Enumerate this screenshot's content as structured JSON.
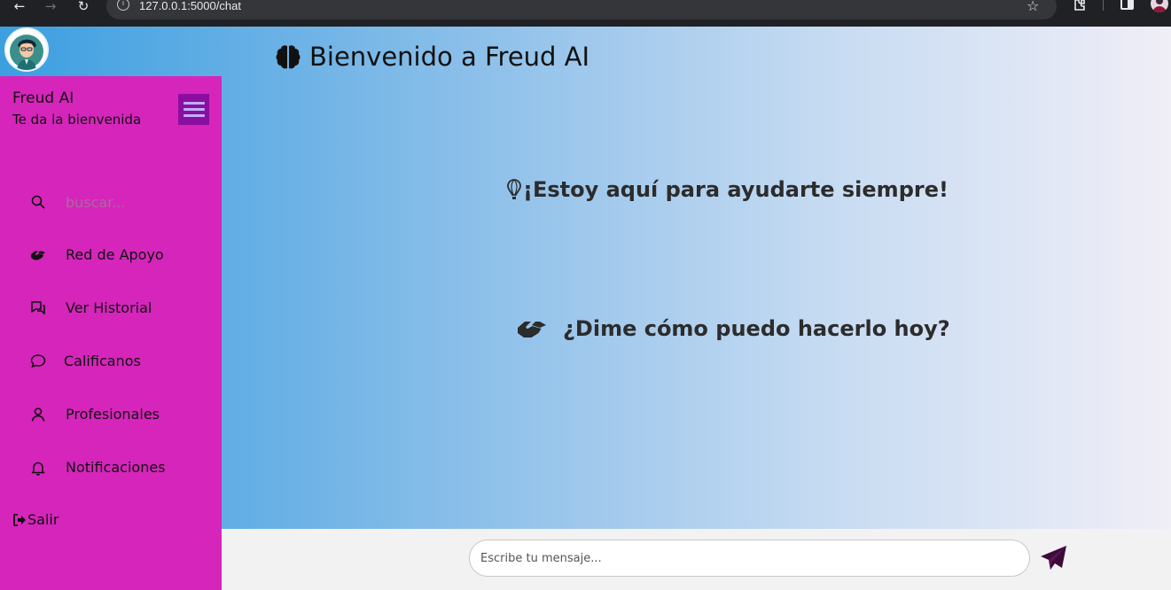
{
  "browser": {
    "url": "127.0.0.1:5000/chat"
  },
  "header": {
    "title": "Bienvenido a Freud AI"
  },
  "sidebar": {
    "brand": "Freud AI",
    "subtitle": "Te da la bienvenida",
    "search_placeholder": "buscar...",
    "items": [
      {
        "label": "Red de Apoyo",
        "icon": "handshake-icon"
      },
      {
        "label": "Ver Historial",
        "icon": "chat-history-icon"
      },
      {
        "label": "Calificanos",
        "icon": "comment-icon"
      },
      {
        "label": "Profesionales",
        "icon": "user-icon"
      },
      {
        "label": "Notificaciones",
        "icon": "bell-icon"
      }
    ],
    "logout": "Salir"
  },
  "main": {
    "headline": "¡Estoy aquí para ayudarte siempre!",
    "prompt": "¿Dime cómo puedo hacerlo hoy?"
  },
  "composer": {
    "placeholder": "Escribe tu mensaje..."
  },
  "colors": {
    "sidebar": "#d625bb",
    "menu_toggle": "#8a0fa0",
    "send_icon": "#3d0b3a",
    "gradient_start": "#3c9fe0",
    "gradient_end": "#f0eef7"
  }
}
